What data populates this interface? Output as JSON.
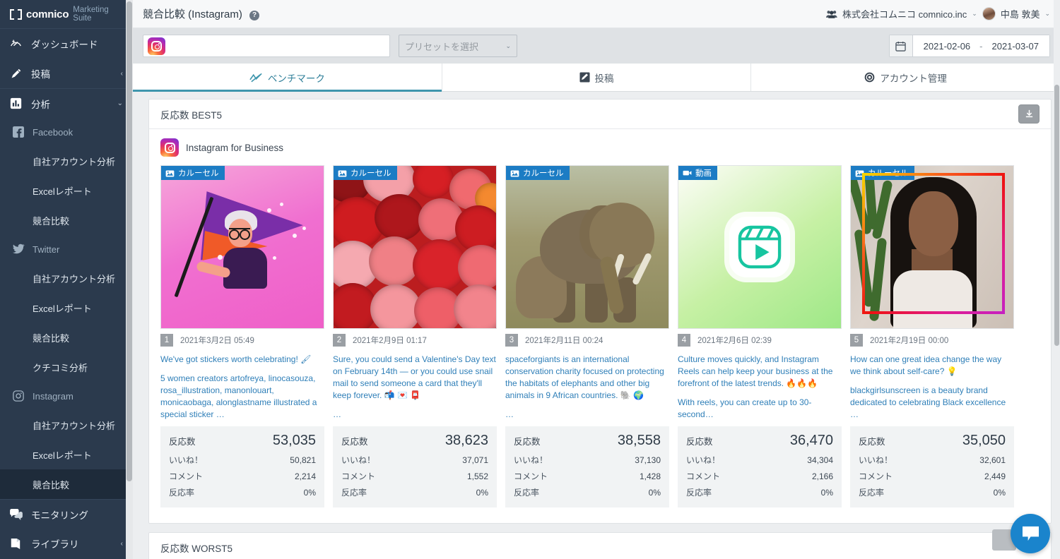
{
  "sidebar": {
    "brand": {
      "name": "comnico",
      "suite": "Marketing Suite"
    },
    "items": [
      {
        "label": "ダッシュボード",
        "icon": "gauge-icon",
        "chevron": ""
      },
      {
        "label": "投稿",
        "icon": "pencil-icon",
        "chevron": "‹"
      },
      {
        "label": "分析",
        "icon": "bar-chart-icon",
        "chevron": "⌄"
      }
    ],
    "groups": [
      {
        "label": "Facebook",
        "icon": "facebook-icon",
        "children": [
          "自社アカウント分析",
          "Excelレポート",
          "競合比較"
        ]
      },
      {
        "label": "Twitter",
        "icon": "twitter-icon",
        "children": [
          "自社アカウント分析",
          "Excelレポート",
          "競合比較",
          "クチコミ分析"
        ]
      },
      {
        "label": "Instagram",
        "icon": "instagram-icon",
        "children": [
          "自社アカウント分析",
          "Excelレポート",
          "競合比較"
        ]
      }
    ],
    "bottom": [
      {
        "label": "モニタリング",
        "icon": "chat-bubbles-icon",
        "chevron": ""
      },
      {
        "label": "ライブラリ",
        "icon": "book-icon",
        "chevron": "‹"
      }
    ],
    "active_child": "競合比較"
  },
  "header": {
    "title": "競合比較 (Instagram)",
    "help": "?",
    "org": "株式会社コムニコ comnico.inc",
    "user": "中島 敦美",
    "caret": "⌄"
  },
  "filters": {
    "account_value": "",
    "preset_placeholder": "プリセットを選択",
    "date_start": "2021-02-06",
    "date_sep": "-",
    "date_end": "2021-03-07"
  },
  "tabs": [
    {
      "label": "ベンチマーク",
      "icon": "trend-line-icon",
      "active": true
    },
    {
      "label": "投稿",
      "icon": "post-icon",
      "active": false
    },
    {
      "label": "アカウント管理",
      "icon": "account-gear-icon",
      "active": false
    }
  ],
  "best_panel": {
    "title": "反応数 BEST5",
    "download_icon": "download-icon",
    "account_name": "Instagram for Business",
    "stat_labels": {
      "reactions": "反応数",
      "likes": "いいね！",
      "comments": "コメント",
      "rate": "反応率"
    },
    "cards": [
      {
        "rank": "1",
        "badge": "カルーセル",
        "badge_icon": "carousel-icon",
        "date": "2021年3月2日 05:49",
        "caption_lines": [
          "We've got stickers worth celebrating! 🖌",
          "5 women creators artofreya, linocasouza, rosa_illustration, manonlouart, monicaobaga, alonglastname illustrated a special sticker …"
        ],
        "reactions": "53,035",
        "likes": "50,821",
        "comments": "2,214",
        "rate": "0%"
      },
      {
        "rank": "2",
        "badge": "カルーセル",
        "badge_icon": "carousel-icon",
        "date": "2021年2月9日 01:17",
        "caption_lines": [
          "Sure, you could send a Valentine's Day text on February 14th — or you could use snail mail to send someone a card that they'll keep forever. 📬 💌 📮",
          "…"
        ],
        "reactions": "38,623",
        "likes": "37,071",
        "comments": "1,552",
        "rate": "0%"
      },
      {
        "rank": "3",
        "badge": "カルーセル",
        "badge_icon": "carousel-icon",
        "date": "2021年2月11日 00:24",
        "caption_lines": [
          "spaceforgiants is an international conservation charity focused on protecting the habitats of elephants and other big animals in 9 African countries. 🐘 🌍",
          "…"
        ],
        "reactions": "38,558",
        "likes": "37,130",
        "comments": "1,428",
        "rate": "0%"
      },
      {
        "rank": "4",
        "badge": "動画",
        "badge_icon": "video-icon",
        "date": "2021年2月6日 02:39",
        "caption_lines": [
          "Culture moves quickly, and Instagram Reels can help keep your business at the forefront of the latest trends. 🔥🔥🔥",
          "With reels, you can create up to 30-second…"
        ],
        "reactions": "36,470",
        "likes": "34,304",
        "comments": "2,166",
        "rate": "0%"
      },
      {
        "rank": "5",
        "badge": "カルーセル",
        "badge_icon": "carousel-icon",
        "date": "2021年2月19日 00:00",
        "caption_lines": [
          "How can one great idea change the way we think about self-care? 💡",
          "blackgirlsunscreen is a beauty brand dedicated to celebrating Black excellence …"
        ],
        "reactions": "35,050",
        "likes": "32,601",
        "comments": "2,449",
        "rate": "0%"
      }
    ]
  },
  "worst_panel": {
    "title": "反応数 WORST5"
  },
  "colors": {
    "sidebar_bg": "#2b3a4d",
    "accent": "#3f96ad",
    "badge_blue": "#1c7cc4",
    "link_blue": "#2f7fb8",
    "chat_blue": "#1a84cc"
  }
}
